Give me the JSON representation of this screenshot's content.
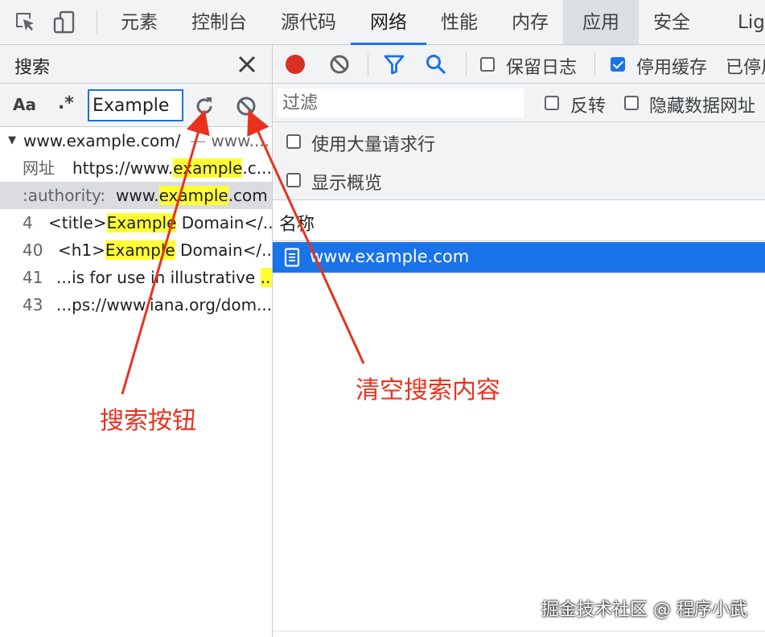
{
  "tabs": [
    {
      "label": "元素"
    },
    {
      "label": "控制台"
    },
    {
      "label": "源代码"
    },
    {
      "label": "网络"
    },
    {
      "label": "性能"
    },
    {
      "label": "内存"
    },
    {
      "label": "应用"
    },
    {
      "label": "安全"
    },
    {
      "label": "Ligh"
    }
  ],
  "search_panel": {
    "title": "搜索",
    "case_option": "Aa",
    "regex_option": ".*",
    "query": "Example",
    "results": [
      {
        "kind": "file",
        "text": "www.example.com/",
        "extra": "www...."
      },
      {
        "kind": "match",
        "label": "网址",
        "pre": "https://www.",
        "hl": "example",
        "post": ".c..."
      },
      {
        "kind": "match",
        "label": ":authority:",
        "pre": "www.",
        "hl": "example",
        "post": ".com"
      },
      {
        "kind": "line",
        "line": "4",
        "pre": "<title>",
        "hl": "Example",
        "post": " Domain</..."
      },
      {
        "kind": "line",
        "line": "40",
        "pre": "<h1>",
        "hl": "Example",
        "post": " Domain</..."
      },
      {
        "kind": "line",
        "line": "41",
        "pre": "...is for use in illustrative ",
        "hl": "...",
        "post": ""
      },
      {
        "kind": "line",
        "line": "43",
        "pre": "...ps://www.iana.org/dom...",
        "hl": "",
        "post": ""
      }
    ]
  },
  "network": {
    "preserve_log": "保留日志",
    "disable_cache": "停用缓存",
    "disable_cache_checked": true,
    "throttle": "已停用",
    "filter_placeholder": "过滤",
    "invert": "反转",
    "hide_data_urls": "隐藏数据网址",
    "big_rows": "使用大量请求行",
    "overview": "显示概览",
    "column_name": "名称",
    "request": "www.example.com"
  },
  "annotations": {
    "search_button": "搜索按钮",
    "clear_search": "清空搜索内容"
  },
  "watermark": "掘金技术社区 @ 程序小武",
  "colors": {
    "accent": "#1a73e8",
    "highlight": "#ffff33",
    "record": "#d93025",
    "annotation": "#e8321e"
  }
}
